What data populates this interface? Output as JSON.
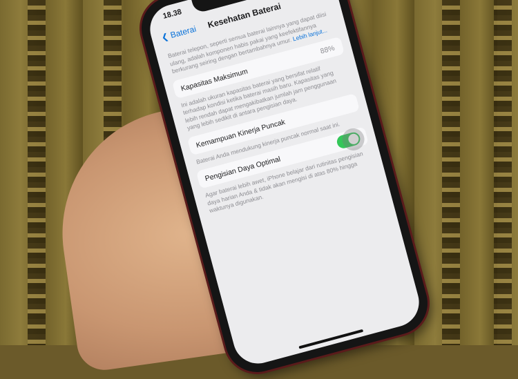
{
  "status": {
    "time": "18.38",
    "signal": "▮▮▮ ≋ ▭"
  },
  "nav": {
    "back_label": "Baterai",
    "title": "Kesehatan Baterai"
  },
  "intro": {
    "text": "Baterai telepon, seperti semua baterai lainnya yang dapat diisi ulang, adalah komponen habis pakai yang keefektifannya berkurang seiring dengan bertambahnya umur.",
    "link": "Lebih lanjut..."
  },
  "capacity": {
    "label": "Kapasitas Maksimum",
    "value": "88%",
    "note": "Ini adalah ukuran kapasitas baterai yang bersifat relatif terhadap kondisi ketika baterai masih baru. Kapasitas yang lebih rendah dapat mengakibatkan jumlah jam penggunaan yang lebih sedikit di antara pengisian daya."
  },
  "peak": {
    "label": "Kemampuan Kinerja Puncak",
    "note": "Baterai Anda mendukung kinerja puncak normal saat ini."
  },
  "optimized": {
    "label": "Pengisian Daya Optimal",
    "enabled": true,
    "note": "Agar baterai lebih awet, iPhone belajar dari rutinitas pengisian daya harian Anda & tidak akan mengisi di atas 80% hingga waktunya digunakan."
  }
}
